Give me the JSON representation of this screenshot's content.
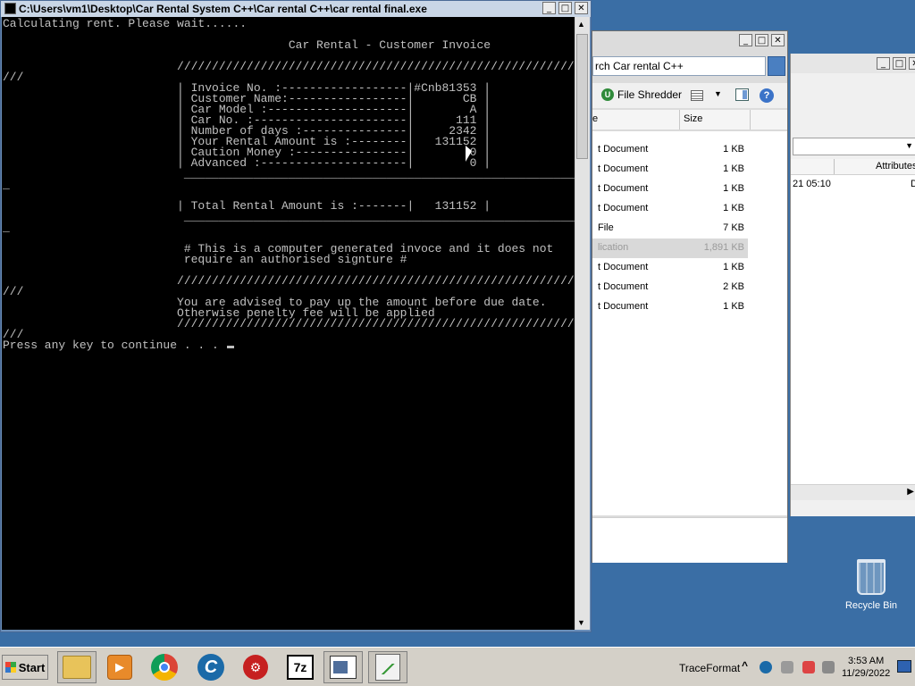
{
  "console": {
    "title": "C:\\Users\\vm1\\Desktop\\Car Rental System C++\\Car rental C++\\car rental final.exe",
    "lines": [
      "Calculating rent. Please wait......",
      "",
      "                                         Car Rental - Customer Invoice",
      "",
      "                         //////////////////////////////////////////////////////////",
      "///",
      "                         | Invoice No. :------------------|#Cnb81353 |",
      "                         | Customer Name:-----------------|       CB |",
      "                         | Car Model :--------------------|        A |",
      "                         | Car No. :----------------------|      111 |",
      "                         | Number of days :---------------|     2342 |",
      "                         | Your Rental Amount is :--------|   131152 |",
      "                         | Caution Money :----------------|        0 |",
      "                         | Advanced :---------------------|        0 |",
      "                          _________________________________________________________",
      "_",
      "",
      "                         | Total Rental Amount is :-------|   131152 |",
      "                          _________________________________________________________",
      "_",
      "",
      "                          # This is a computer generated invoce and it does not",
      "                          require an authorised signture #",
      "",
      "                         //////////////////////////////////////////////////////////",
      "///",
      "                         You are advised to pay up the amount before due date.",
      "                         Otherwise penelty fee will be applied",
      "                         //////////////////////////////////////////////////////////",
      "///",
      "Press any key to continue . . . "
    ]
  },
  "explorer_mid": {
    "search_text": "rch Car rental C++",
    "toolbar": {
      "shredder_label": "File Shredder"
    },
    "columns": {
      "name": "e",
      "size": "Size"
    },
    "files": [
      {
        "name": "t Document",
        "size": "1 KB",
        "selected": false
      },
      {
        "name": "t Document",
        "size": "1 KB",
        "selected": false
      },
      {
        "name": "t Document",
        "size": "1 KB",
        "selected": false
      },
      {
        "name": "t Document",
        "size": "1 KB",
        "selected": false
      },
      {
        "name": "File",
        "size": "7 KB",
        "selected": false
      },
      {
        "name": "lication",
        "size": "1,891 KB",
        "selected": true
      },
      {
        "name": "t Document",
        "size": "1 KB",
        "selected": false
      },
      {
        "name": "t Document",
        "size": "2 KB",
        "selected": false
      },
      {
        "name": "t Document",
        "size": "1 KB",
        "selected": false
      }
    ]
  },
  "explorer_far": {
    "column_attributes": "Attributes",
    "row_date": "21 05:10",
    "row_attr": "D"
  },
  "desktop": {
    "recycle_bin_label": "Recycle Bin"
  },
  "taskbar": {
    "start_label": "Start",
    "tray_label": "TraceFormat",
    "time": "3:53 AM",
    "date": "11/29/2022",
    "sevenzip_label": "7z"
  }
}
